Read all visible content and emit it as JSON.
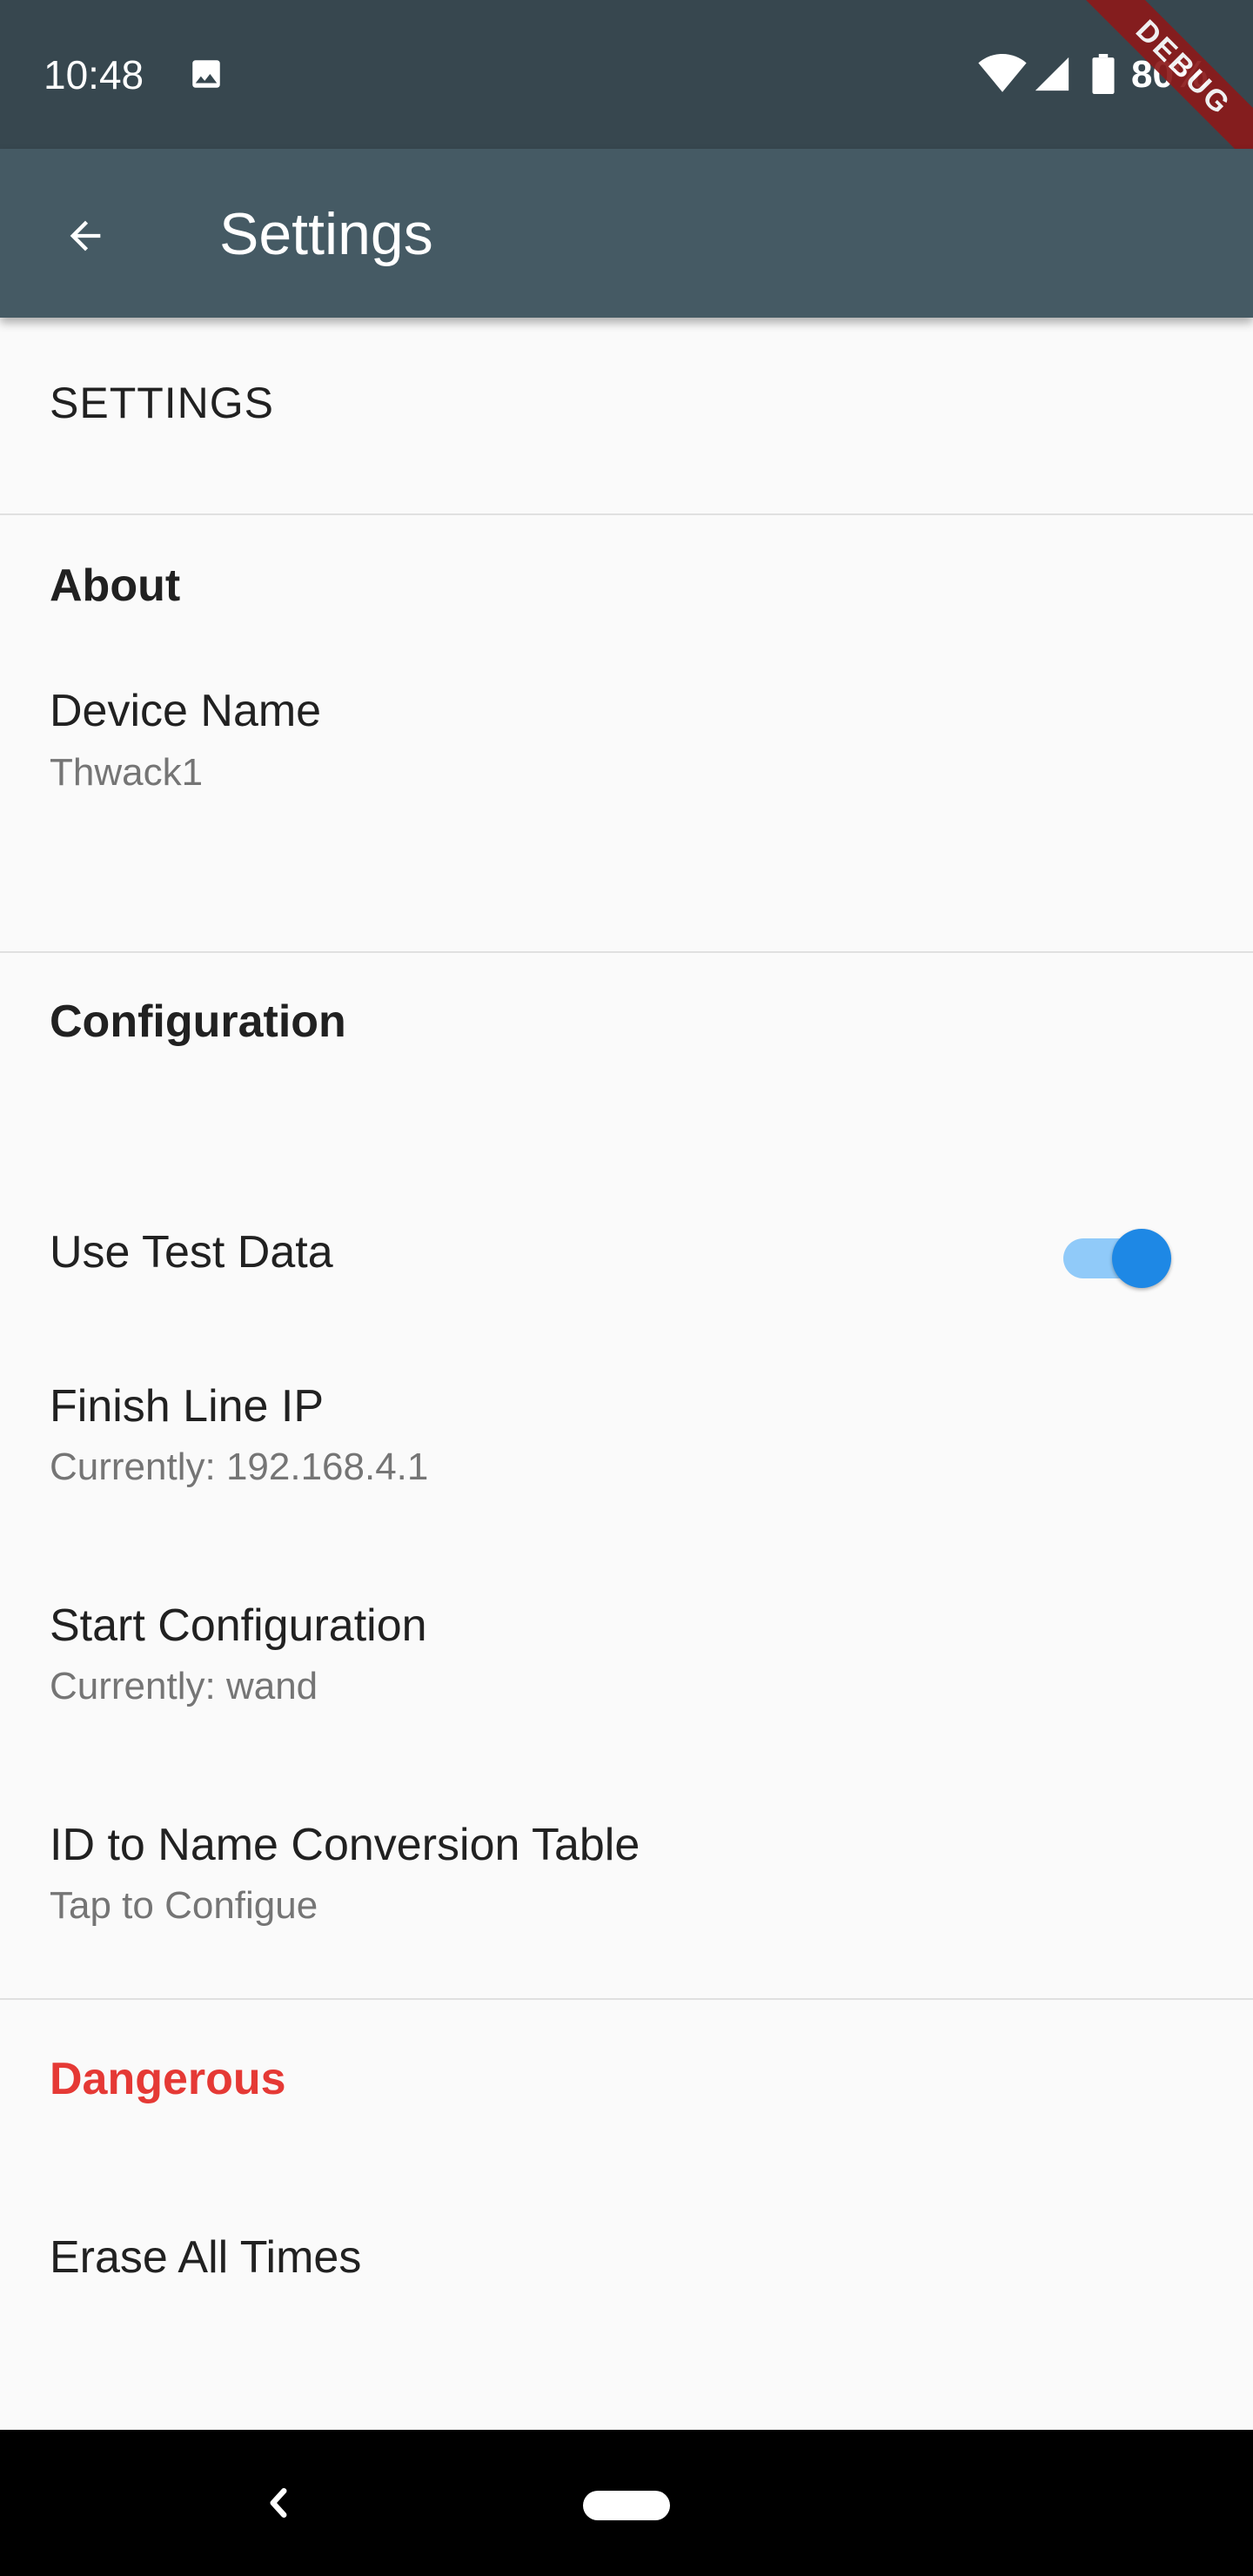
{
  "status_bar": {
    "time": "10:48",
    "battery": "80%",
    "debug_label": "DEBUG",
    "icons": [
      "image-icon",
      "wifi-icon",
      "signal-icon",
      "battery-icon"
    ]
  },
  "app_bar": {
    "title": "Settings",
    "back_icon": "arrow-back-icon"
  },
  "header": "SETTINGS",
  "sections": {
    "about": {
      "title": "About",
      "device_name": {
        "title": "Device Name",
        "subtitle": "Thwack1"
      }
    },
    "configuration": {
      "title": "Configuration",
      "use_test_data": {
        "title": "Use Test Data",
        "enabled": true
      },
      "finish_line_ip": {
        "title": "Finish Line IP",
        "subtitle": "Currently: 192.168.4.1"
      },
      "start_configuration": {
        "title": "Start Configuration",
        "subtitle": "Currently: wand"
      },
      "id_table": {
        "title": "ID to Name Conversion Table",
        "subtitle": "Tap to Configue"
      }
    },
    "dangerous": {
      "title": "Dangerous",
      "erase_all": {
        "title": "Erase All Times"
      }
    }
  },
  "colors": {
    "status_bar": "#37474F",
    "app_bar": "#455A64",
    "danger": "#E53935",
    "switch_accent": "#1E88E5"
  },
  "nav_bar": {
    "icons": [
      "nav-back-icon",
      "nav-home-pill"
    ]
  }
}
